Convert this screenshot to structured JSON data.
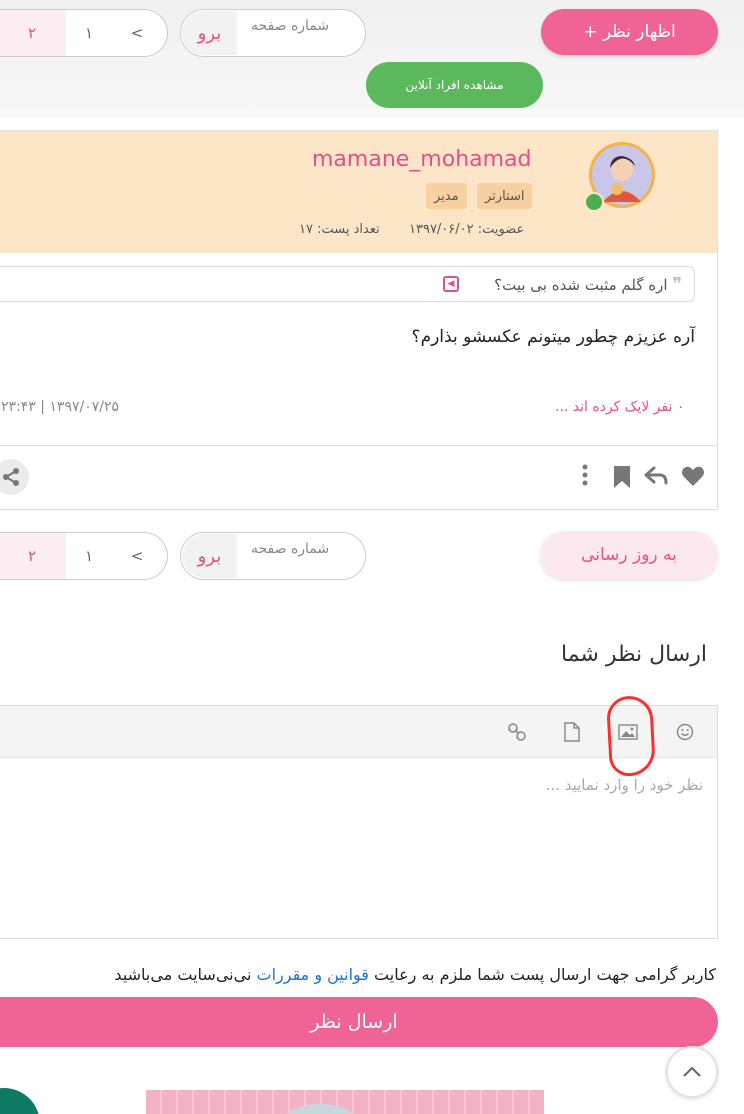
{
  "top": {
    "comment_button": "+ اظهار نظر",
    "online_button": "مشاهده افراد آنلاین",
    "page_jump_label": "شماره صفحه",
    "page_jump_go": "برو",
    "pager": {
      "prev": "<",
      "page1": "۱",
      "page2": "۲"
    }
  },
  "post": {
    "username": "mamane_mohamad",
    "badges": [
      "استارتر",
      "مدیر"
    ],
    "membership": "عضویت: ۱۳۹۷/۰۶/۰۲",
    "post_count": "تعداد پست: ۱۷",
    "quote_text": "اره گلم مثبت شده بی بیت؟",
    "body": "آره عزیزم چطور میتونم عکسشو بذارم؟",
    "likes": "۰ نفر لایک کرده اند ...",
    "date": "۲۳:۴۳ | ۱۳۹۷/۰۷/۲۵"
  },
  "bottom_nav": {
    "refresh_button": "به روز رسانی",
    "page_jump_label": "شماره صفحه",
    "page_jump_go": "برو",
    "pager": {
      "prev": "<",
      "page1": "۱",
      "page2": "۲"
    }
  },
  "editor": {
    "title": "ارسال نظر شما",
    "placeholder": "نظر خود را وارد نمایید ...",
    "toolbar_icons": [
      "smiley-icon",
      "image-icon",
      "file-icon",
      "link-icon"
    ]
  },
  "rules": {
    "prefix": "کاربر گرامی جهت ارسال پست شما ملزم به رعایت",
    "link": "قوانین و مقررات",
    "suffix": "نی‌نی‌سایت می‌باشید"
  },
  "submit_button": "ارسال نظر",
  "colors": {
    "accent": "#ef6494",
    "online": "#5cb85c",
    "post_header": "#fde6c8"
  }
}
